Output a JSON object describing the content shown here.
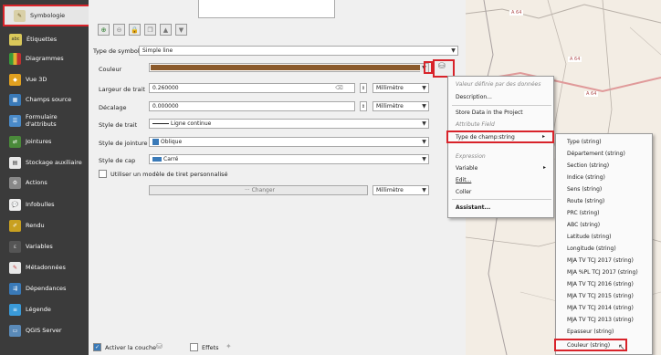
{
  "sidebar": {
    "items": [
      {
        "label": "Symbologie"
      },
      {
        "label": "Étiquettes",
        "badge": "abc"
      },
      {
        "label": "Diagrammes"
      },
      {
        "label": "Vue 3D"
      },
      {
        "label": "Champs source"
      },
      {
        "label": "Formulaire d'attributs"
      },
      {
        "label": "Jointures"
      },
      {
        "label": "Stockage auxiliaire"
      },
      {
        "label": "Actions"
      },
      {
        "label": "Infobulles"
      },
      {
        "label": "Rendu"
      },
      {
        "label": "Variables"
      },
      {
        "label": "Métadonnées"
      },
      {
        "label": "Dépendances"
      },
      {
        "label": "Légende"
      },
      {
        "label": "QGIS Server"
      }
    ]
  },
  "form": {
    "symbol_type_label": "Type de symbole",
    "symbol_type_value": "Simple line",
    "color_label": "Couleur",
    "color_value": "#8b5a2b",
    "stroke_width_label": "Largeur de trait",
    "stroke_width_value": "0.260000",
    "stroke_width_unit": "Millimètre",
    "offset_label": "Décalage",
    "offset_value": "0.000000",
    "offset_unit": "Millimètre",
    "stroke_style_label": "Style de trait",
    "stroke_style_value": "Ligne continue",
    "join_style_label": "Style de jointure",
    "join_style_value": "Oblique",
    "cap_style_label": "Style de cap",
    "cap_style_value": "Carré",
    "custom_dash_label": "Utiliser un modèle de tiret personnalisé",
    "change_label": "··· Changer",
    "dash_unit": "Millimètre"
  },
  "footer": {
    "activate_layer_label": "Activer la couche",
    "effects_label": "Effets"
  },
  "context_menu": {
    "header": "Valeur définie par des données",
    "description": "Description...",
    "store_data": "Store Data in the Project",
    "attribute_field": "Attribute Field",
    "field_type": "Type de champ:string",
    "expression": "Expression",
    "variable": "Variable",
    "edit": "Edit...",
    "paste": "Coller",
    "assistant": "Assistant..."
  },
  "submenu": {
    "items": [
      "Type  (string)",
      "Département  (string)",
      "Section  (string)",
      "Indice  (string)",
      "Sens  (string)",
      "Route  (string)",
      "PRC  (string)",
      "ABC  (string)",
      "Latitude  (string)",
      "Longitude  (string)",
      "MJA TV TCJ 2017  (string)",
      "MJA %PL TCJ 2017  (string)",
      "MJA TV TCJ 2016  (string)",
      "MJA TV TCJ 2015  (string)",
      "MJA TV TCJ 2014  (string)",
      "MJA TV TCJ 2013  (string)",
      "Epasseur  (string)",
      "Couleur  (string)"
    ]
  },
  "map": {
    "road_labels": [
      "A 64",
      "A 64",
      "A 64"
    ]
  }
}
